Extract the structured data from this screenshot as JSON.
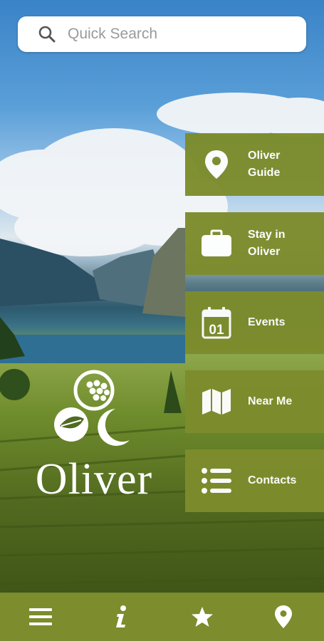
{
  "search": {
    "placeholder": "Quick Search",
    "icon": "search-icon"
  },
  "menu": {
    "accent_color": "#7d8c2c",
    "items": [
      {
        "label": "Oliver\nGuide",
        "icon": "map-pin-icon"
      },
      {
        "label": "Stay in\nOliver",
        "icon": "briefcase-icon"
      },
      {
        "label": "Events",
        "icon": "calendar-icon",
        "calendar_day": "01"
      },
      {
        "label": "Near Me",
        "icon": "map-icon"
      },
      {
        "label": "Contacts",
        "icon": "list-icon"
      }
    ]
  },
  "logo": {
    "wordmark": "Oliver"
  },
  "tabbar": {
    "tabs": [
      {
        "icon": "hamburger-menu-icon"
      },
      {
        "icon": "info-icon"
      },
      {
        "icon": "star-icon"
      },
      {
        "icon": "location-pin-icon"
      }
    ]
  }
}
